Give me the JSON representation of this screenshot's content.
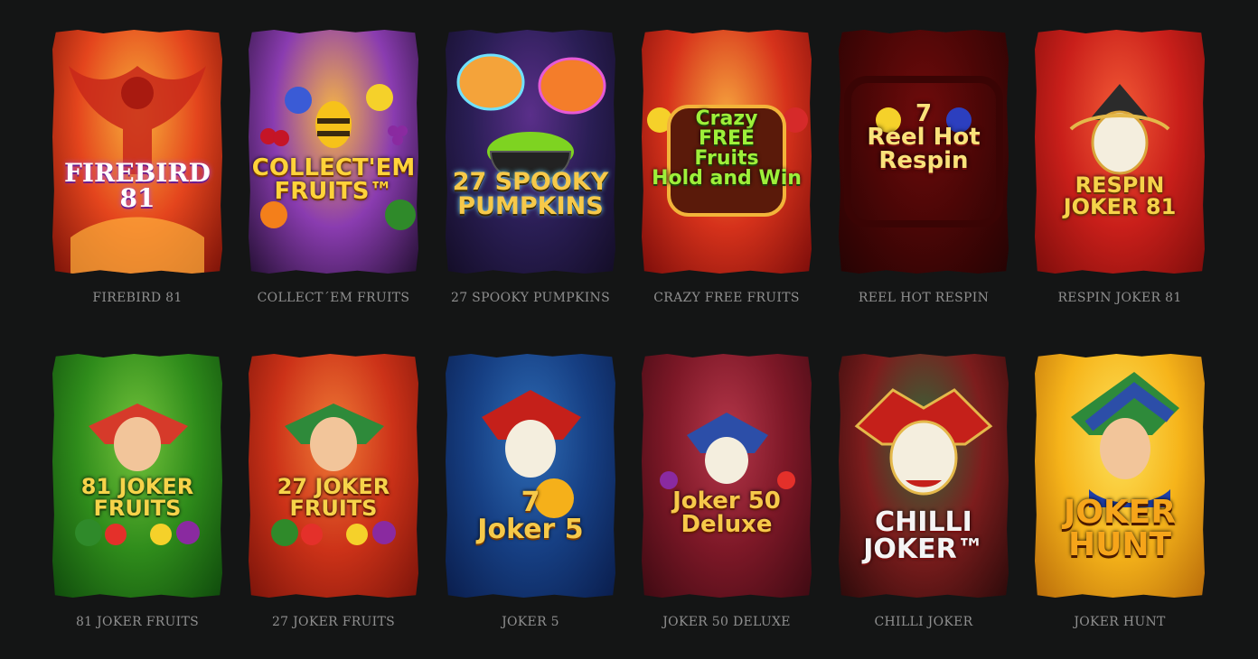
{
  "games": [
    {
      "title": "FIREBIRD 81",
      "logo": "FIREBIRD\n81",
      "bg": [
        "#f8b03a",
        "#e4451d",
        "#7b1208"
      ]
    },
    {
      "title": "COLLECT´EM FRUITS",
      "logo": "COLLECT'EM\nFRUITS™",
      "bg": [
        "#f6b545",
        "#8a3cb0",
        "#251034"
      ]
    },
    {
      "title": "27 SPOOKY PUMPKINS",
      "logo": "27 SPOOKY\nPUMPKINS",
      "bg": [
        "#5a2f8a",
        "#2a1e55",
        "#130d26"
      ]
    },
    {
      "title": "CRAZY FREE FRUITS",
      "logo": "Crazy\nFREE\nFruits\nHold and Win",
      "bg": [
        "#f6a33d",
        "#d6321b",
        "#7c0d0a"
      ]
    },
    {
      "title": "REEL HOT RESPIN",
      "logo": "7\nReel Hot\nRespin",
      "bg": [
        "#6e0b0b",
        "#4a0606",
        "#250303"
      ]
    },
    {
      "title": "RESPIN JOKER 81",
      "logo": "RESPIN\nJOKER 81",
      "bg": [
        "#f35a36",
        "#c91f1a",
        "#7d0d0b"
      ]
    },
    {
      "title": "81 JOKER FRUITS",
      "logo": "81 JOKER\nFRUITS",
      "bg": [
        "#74c33b",
        "#2f8c1b",
        "#0f4a0c"
      ]
    },
    {
      "title": "27 JOKER FRUITS",
      "logo": "27 JOKER\nFRUITS",
      "bg": [
        "#f07b36",
        "#cc3218",
        "#7b140a"
      ]
    },
    {
      "title": "JOKER 5",
      "logo": "7\nJoker 5",
      "bg": [
        "#2e6cb6",
        "#163f83",
        "#0a1d4c"
      ]
    },
    {
      "title": "JOKER 50 DELUXE",
      "logo": "Joker 50\nDeluxe",
      "bg": [
        "#b6374a",
        "#7d1827",
        "#3e0a12"
      ]
    },
    {
      "title": "CHILLI JOKER",
      "logo": "CHILLI\nJOKER™",
      "bg": [
        "#2f6b3b",
        "#7d1d1d",
        "#2b0a0a"
      ]
    },
    {
      "title": "JOKER HUNT",
      "logo": "JOKER\nHUNT",
      "bg": [
        "#fde25a",
        "#f6b41a",
        "#b86b0a"
      ]
    }
  ]
}
